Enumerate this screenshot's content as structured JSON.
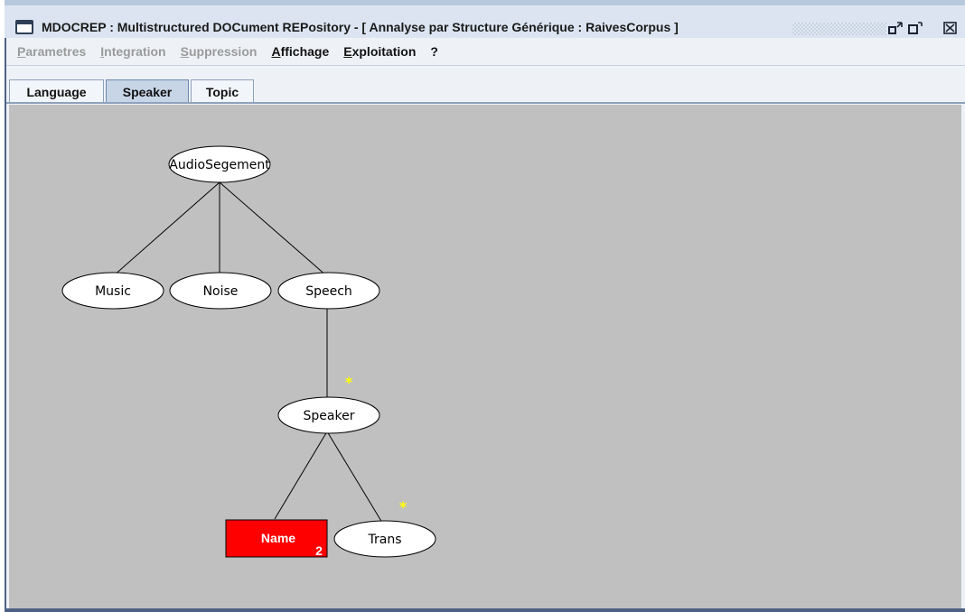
{
  "window": {
    "title": "MDOCREP : Multistructured DOCument REPository - [ Annalyse par Structure Générique : RaivesCorpus ]",
    "controls": [
      "restore-icon",
      "maximize-icon",
      "close-icon"
    ]
  },
  "menu": {
    "items": [
      {
        "first": "P",
        "rest": "arametres",
        "enabled": false
      },
      {
        "first": "I",
        "rest": "ntegration",
        "enabled": false
      },
      {
        "first": "S",
        "rest": "uppression",
        "enabled": false
      },
      {
        "first": "A",
        "rest": "ffichage",
        "enabled": true
      },
      {
        "first": "E",
        "rest": "xploitation",
        "enabled": true
      },
      {
        "first": "",
        "rest": "?",
        "enabled": true
      }
    ]
  },
  "tabs": {
    "items": [
      {
        "label": "Language",
        "active": false
      },
      {
        "label": "Speaker",
        "active": true
      },
      {
        "label": "Topic",
        "active": false
      }
    ]
  },
  "tree": {
    "nodes": {
      "audio": "AudioSegement",
      "music": "Music",
      "noise": "Noise",
      "speech": "Speech",
      "speaker": "Speaker",
      "name": "Name",
      "trans": "Trans"
    },
    "name_count": "2",
    "repeat_marker": "*",
    "selected_color": "#ff0000",
    "marker_color": "#ffff00"
  }
}
